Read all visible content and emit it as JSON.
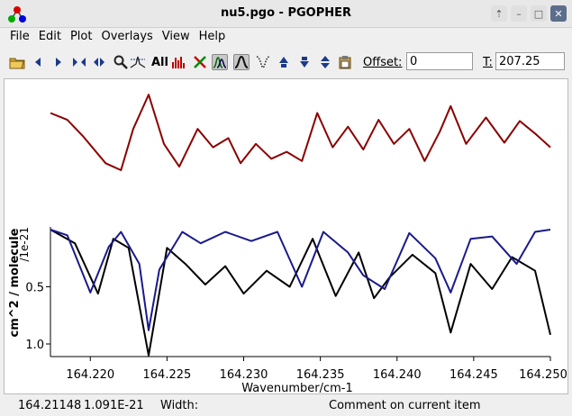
{
  "window": {
    "title": "nu5.pgo - PGOPHER"
  },
  "menu": [
    "File",
    "Edit",
    "Plot",
    "Overlays",
    "View",
    "Help"
  ],
  "toolbar": {
    "all_label": "All",
    "offset_label": "Offset:",
    "offset_value": "0",
    "t_label": "T:",
    "t_value": "207.25"
  },
  "colors": {
    "simulation": "#8b0000",
    "total": "#000000",
    "components": [
      "#1a1a8c",
      "#008080",
      "#ffa500",
      "#e00000",
      "#00008b",
      "#ff8c00",
      "#a0522d"
    ]
  },
  "chart_data": {
    "type": "line",
    "xlabel": "Wavenumber/cm-1",
    "ylabel": "cm^2 / molecule",
    "y_scale_label": "/1e-21",
    "xlim": [
      164.2174,
      164.25
    ],
    "x_ticks": [
      "164.220",
      "164.225",
      "164.230",
      "164.235",
      "164.240",
      "164.245",
      "164.250"
    ],
    "y_ticks": [
      "0.5",
      "1.0"
    ],
    "series": [
      {
        "type": "line",
        "x": [
          164.2174,
          164.2185,
          164.2195,
          164.221,
          164.222,
          164.2228,
          164.2238,
          164.2248,
          164.2258,
          164.227,
          164.228,
          164.229,
          164.2298,
          164.2308,
          164.2318,
          164.2328,
          164.2338,
          164.2348,
          164.2358,
          164.2368,
          164.2378,
          164.2388,
          164.2398,
          164.2408,
          164.2418,
          164.2428,
          164.2435,
          164.2445,
          164.2458,
          164.247,
          164.248,
          164.249,
          164.25
        ],
        "y": [
          -1.02,
          -0.96,
          -0.82,
          -0.58,
          -0.52,
          -0.88,
          -1.18,
          -0.75,
          -0.55,
          -0.88,
          -0.72,
          -0.8,
          -0.58,
          -0.75,
          -0.62,
          -0.68,
          -0.6,
          -1.02,
          -0.72,
          -0.9,
          -0.7,
          -0.96,
          -0.75,
          -0.88,
          -0.6,
          -0.86,
          -1.08,
          -0.75,
          -0.98,
          -0.76,
          -0.95,
          -0.84,
          -0.72
        ]
      },
      {
        "type": "line",
        "x": [
          164.2174,
          164.219,
          164.2205,
          164.2215,
          164.2225,
          164.2238,
          164.225,
          164.2262,
          164.2275,
          164.2288,
          164.23,
          164.2315,
          164.233,
          164.2345,
          164.236,
          164.2375,
          164.2385,
          164.2395,
          164.241,
          164.2425,
          164.2435,
          164.2448,
          164.2462,
          164.2475,
          164.249,
          164.25
        ],
        "y": [
          0.0,
          0.12,
          0.56,
          0.08,
          0.16,
          1.1,
          0.16,
          0.3,
          0.48,
          0.32,
          0.56,
          0.36,
          0.5,
          0.08,
          0.58,
          0.2,
          0.6,
          0.42,
          0.22,
          0.38,
          0.9,
          0.3,
          0.52,
          0.24,
          0.36,
          0.92
        ]
      },
      {
        "type": "line",
        "x": [
          164.2174,
          164.2185,
          164.22,
          164.2212,
          164.222,
          164.2232,
          164.2238,
          164.2245,
          164.226,
          164.2272,
          164.2288,
          164.2305,
          164.2322,
          164.2338,
          164.2352,
          164.2368,
          164.2378,
          164.2392,
          164.2408,
          164.2425,
          164.2435,
          164.2448,
          164.2462,
          164.2478,
          164.249,
          164.25
        ],
        "y": [
          0.0,
          0.05,
          0.55,
          0.15,
          0.02,
          0.3,
          0.88,
          0.35,
          0.02,
          0.12,
          0.02,
          0.1,
          0.02,
          0.5,
          0.02,
          0.2,
          0.4,
          0.52,
          0.03,
          0.25,
          0.55,
          0.08,
          0.06,
          0.3,
          0.02,
          0.0
        ]
      }
    ]
  },
  "status": {
    "x": "164.21148",
    "y": "1.091E-21",
    "width_label": "Width:",
    "comment": "Comment on current item"
  }
}
